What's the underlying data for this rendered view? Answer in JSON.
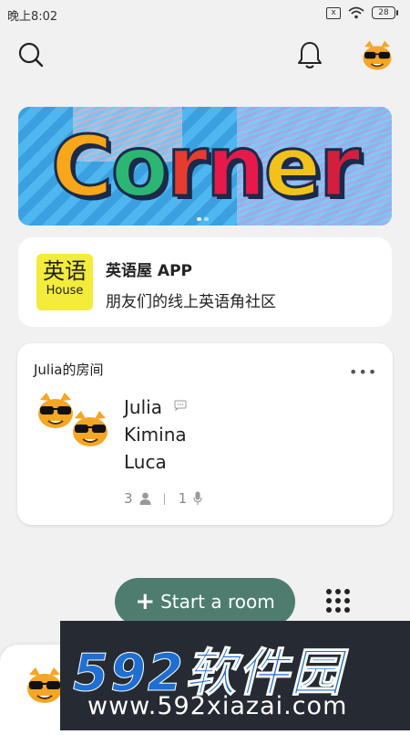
{
  "status_bar": {
    "time": "晚上8:02",
    "battery": "28",
    "notification_badge": "x"
  },
  "header": {
    "search_icon": "search-icon",
    "bell_icon": "bell-icon",
    "profile_avatar": "cat-sunglasses-avatar"
  },
  "banner": {
    "word": [
      "C",
      "o",
      "r",
      "n",
      "e",
      "r"
    ],
    "letter_colors": [
      "#f9a61a",
      "#2bb673",
      "#e63b2e",
      "#e6194b",
      "#f2c21a",
      "#d11f3d"
    ],
    "page_count": 2,
    "active_page": 1
  },
  "app_card": {
    "logo_zh": "英语",
    "logo_en": "House",
    "title": "英语屋 APP",
    "subtitle": "朋友们的线上英语角社区"
  },
  "room": {
    "title": "Julia的房间",
    "more": "•••",
    "members": [
      "Julia",
      "Kimina",
      "Luca"
    ],
    "listener_count": "3",
    "separator": "|",
    "speaker_count": "1"
  },
  "actions": {
    "start_room_plus": "+",
    "start_room_label": "Start a room",
    "accent_color": "#4e7d70"
  },
  "watermark": {
    "big": "592软件园",
    "small": "www.592xiazai.com"
  }
}
